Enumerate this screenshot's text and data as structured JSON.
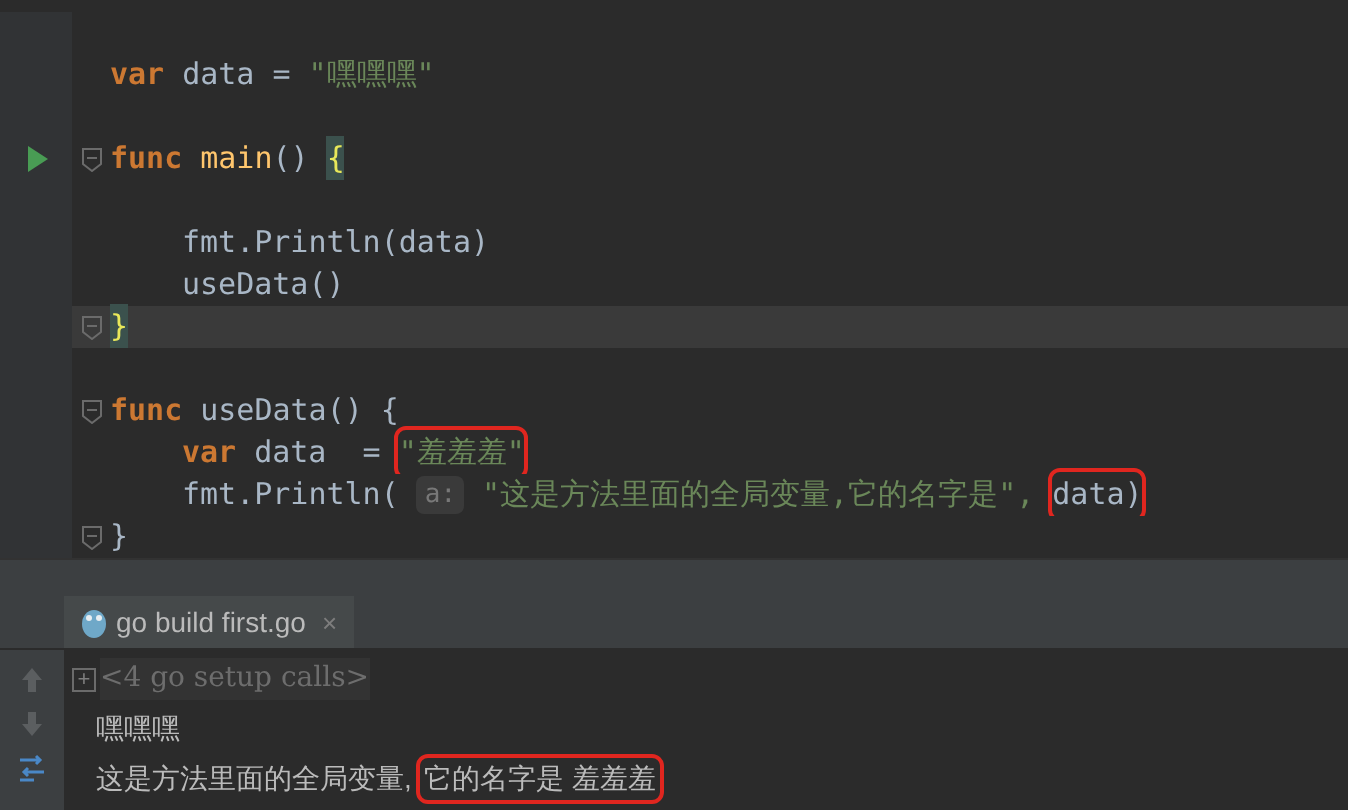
{
  "editor": {
    "lines": [
      {
        "fold": false,
        "run": false,
        "current": false
      },
      {
        "tokens": [
          {
            "text": "var",
            "kind": "keyword",
            "boxed": false
          },
          {
            "text": "data =",
            "kind": "plain",
            "boxed": false
          },
          {
            "text": "\"嘿嘿嘿\"",
            "kind": "string",
            "boxed": false
          }
        ],
        "fold": false,
        "run": false,
        "current": false,
        "indent": false
      },
      {
        "fold": false,
        "run": false,
        "current": false
      },
      {
        "tokens": [
          {
            "text": "func",
            "kind": "keyword",
            "boxed": false
          },
          {
            "text": "main",
            "kind": "function",
            "boxed": false
          },
          {
            "text": "()",
            "kind": "plain",
            "boxed": false
          },
          {
            "text": "{",
            "kind": "brace",
            "boxed": false
          }
        ],
        "fold": true,
        "run": true,
        "current": false,
        "indent": false
      },
      {
        "fold": false,
        "run": false,
        "current": false
      },
      {
        "tokens": [
          {
            "text": "fmt.Println(data)",
            "kind": "plain",
            "boxed": false
          }
        ],
        "fold": false,
        "run": false,
        "current": false,
        "indent": true
      },
      {
        "tokens": [
          {
            "text": "useData()",
            "kind": "plain",
            "boxed": false
          }
        ],
        "fold": false,
        "run": false,
        "current": false,
        "indent": true
      },
      {
        "tokens": [
          {
            "text": "}",
            "kind": "brace",
            "boxed": false
          }
        ],
        "fold": true,
        "run": false,
        "current": true,
        "indent": false
      },
      {
        "fold": false,
        "run": false,
        "current": false
      },
      {
        "tokens": [
          {
            "text": "func",
            "kind": "keyword",
            "boxed": false
          },
          {
            "text": "useData() {",
            "kind": "plain",
            "boxed": false
          }
        ],
        "fold": true,
        "run": false,
        "current": false,
        "indent": false
      },
      {
        "tokens": [
          {
            "text": "var",
            "kind": "keyword",
            "boxed": false
          },
          {
            "text": "data  =",
            "kind": "plain",
            "boxed": false
          },
          {
            "text": "\"羞羞羞\"",
            "kind": "string",
            "boxed": true
          }
        ],
        "fold": false,
        "run": false,
        "current": false,
        "indent": true
      },
      {
        "tokens": [
          {
            "text": "fmt.Println(",
            "kind": "plain",
            "boxed": false
          },
          {
            "text": "a:",
            "kind": "hint",
            "boxed": false
          },
          {
            "text": "\"这是方法里面的全局变量,它的名字是\",",
            "kind": "string",
            "boxed": false
          },
          {
            "text": "data)",
            "kind": "plain",
            "boxed": true
          }
        ],
        "fold": false,
        "run": false,
        "current": false,
        "indent": true
      },
      {
        "tokens": [
          {
            "text": "}",
            "kind": "plain",
            "boxed": false
          }
        ],
        "fold": true,
        "run": false,
        "current": false,
        "indent": false
      }
    ]
  },
  "run_panel": {
    "tab": {
      "label": "go build first.go",
      "close": "×"
    },
    "folded": {
      "expander": "+",
      "text": "<4 go setup calls>"
    },
    "output": [
      {
        "segments": [
          {
            "text": "嘿嘿嘿",
            "boxed": false
          }
        ]
      },
      {
        "segments": [
          {
            "text": "这是方法里面的全局变量,",
            "boxed": false
          },
          {
            "text": "它的名字是 羞羞羞",
            "boxed": true
          }
        ]
      }
    ]
  }
}
